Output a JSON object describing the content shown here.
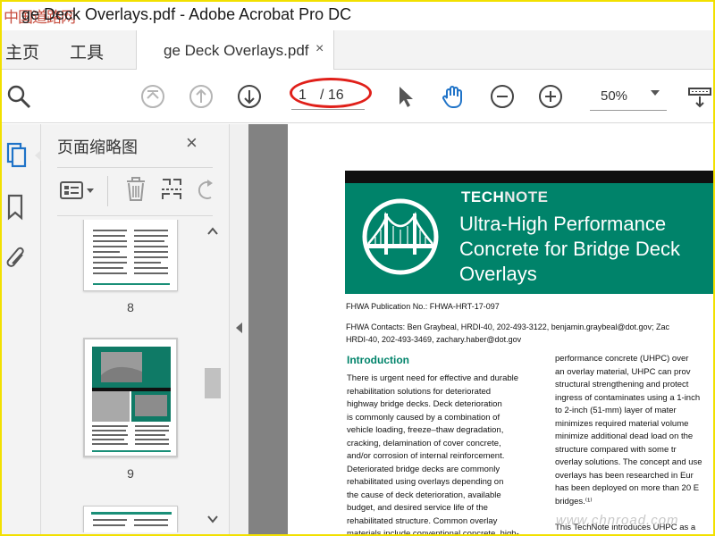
{
  "window": {
    "watermark_text": "中国道路网",
    "title": "ge Deck Overlays.pdf - Adobe Acrobat Pro DC"
  },
  "tabs": {
    "home": "主页",
    "tools": "工具",
    "document": "ge Deck Overlays.pdf",
    "close_glyph": "×"
  },
  "toolbar": {
    "current_page": "1",
    "total_pages": "/ 16",
    "zoom": "50%"
  },
  "panel": {
    "title": "页面缩略图",
    "close_glyph": "×",
    "thumbnails": [
      {
        "page": "8"
      },
      {
        "page": "9"
      }
    ]
  },
  "document": {
    "technote_tech": "TECH",
    "technote_note": "NOTE",
    "headline": "Ultra-High Performance Concrete for Bridge Deck Overlays",
    "publication": "FHWA Publication No.: FHWA-HRT-17-097",
    "contacts_line1": "FHWA Contacts: Ben Graybeal, HRDI-40, 202-493-3122, benjamin.graybeal@dot.gov; Zac",
    "contacts_line2": "HRDI-40, 202-493-3469, zachary.haber@dot.gov",
    "intro_heading": "Introduction",
    "col1_lines": [
      "There is urgent need for effective and durable",
      "rehabilitation solutions for deteriorated",
      "highway bridge decks. Deck deterioration",
      "is commonly caused by a combination of",
      "vehicle loading, freeze–thaw degradation,",
      "cracking, delamination of cover concrete,",
      "and/or corrosion of internal reinforcement.",
      "Deteriorated bridge decks are commonly",
      "rehabilitated using overlays depending on",
      "the cause of deck deterioration, available",
      "budget, and desired service life of the",
      "rehabilitated structure. Common overlay",
      "materials include conventional concrete, high-"
    ],
    "col2_lines": [
      "performance concrete (UHPC) over",
      "an overlay material, UHPC can prov",
      "structural strengthening and protect",
      "ingress of contaminates using a 1-inch",
      "to 2-inch (51-mm) layer of mater",
      "minimizes required material volume",
      "minimize additional dead load on the",
      "structure compared with some tr",
      "overlay solutions. The concept and use",
      "overlays has been researched in Eur",
      "has been deployed on more than 20 E",
      "bridges.⁽¹⁾",
      "",
      "This TechNote introduces UHPC as a"
    ]
  },
  "footer_watermark": "www.chnroad.com"
}
